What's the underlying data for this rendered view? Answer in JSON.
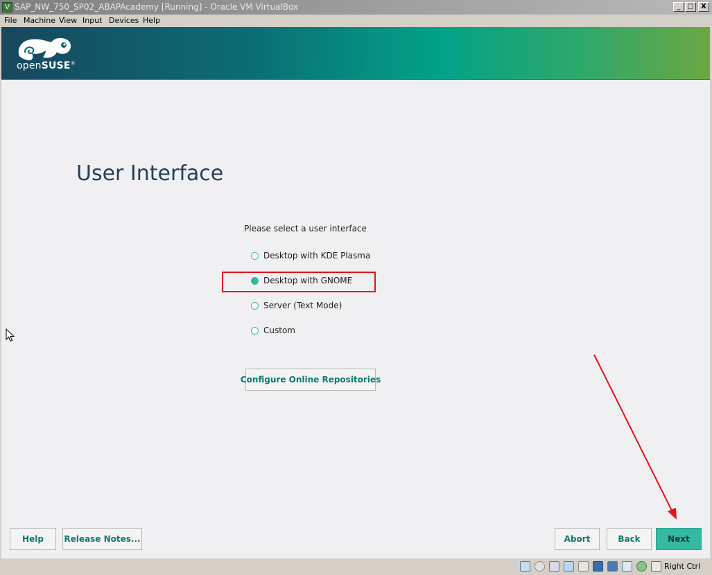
{
  "window": {
    "title": "SAP_NW_750_SP02_ABAPAcademy [Running] - Oracle VM VirtualBox",
    "minimize_glyph": "_",
    "maximize_glyph": "□",
    "close_glyph": "X"
  },
  "menu": {
    "items": [
      {
        "label": "File"
      },
      {
        "label": "Machine"
      },
      {
        "label": "View"
      },
      {
        "label": "Input"
      },
      {
        "label": "Devices"
      },
      {
        "label": "Help"
      }
    ]
  },
  "banner": {
    "logo_prefix": "open",
    "logo_suffix": "SUSE",
    "logo_mark": "®",
    "logo_icon": "opensuse-chameleon-icon"
  },
  "page": {
    "title": "User Interface",
    "prompt": "Please select a user interface",
    "options": [
      {
        "label": "Desktop with KDE Plasma",
        "selected": false
      },
      {
        "label": "Desktop with GNOME",
        "selected": true
      },
      {
        "label": "Server (Text Mode)",
        "selected": false
      },
      {
        "label": "Custom",
        "selected": false
      }
    ],
    "configure_button": "Configure Online Repositories"
  },
  "footer": {
    "help": "Help",
    "release_notes": "Release Notes...",
    "abort": "Abort",
    "back": "Back",
    "next": "Next"
  },
  "annotations": {
    "highlight_color": "#e8101c",
    "arrow_color": "#e8101c"
  },
  "colors": {
    "accent": "#35b9a3",
    "button_text": "#0c7b6a",
    "title_text": "#263f52"
  },
  "statusbar": {
    "icons": [
      "hard-disk-icon",
      "optical-drive-icon",
      "audio-icon",
      "network-icon",
      "usb-icon",
      "shared-folders-icon",
      "display-icon",
      "video-capture-icon",
      "cpu-icon",
      "mouse-integration-icon",
      "keyboard-icon"
    ],
    "host_key": "Right Ctrl"
  }
}
